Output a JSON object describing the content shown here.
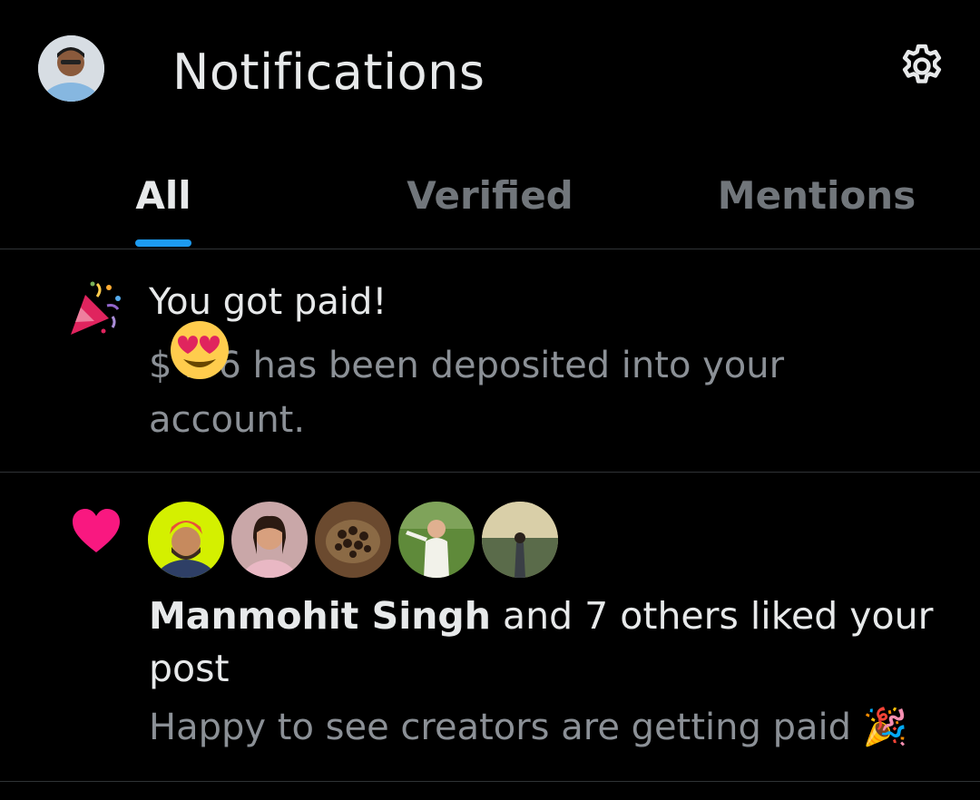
{
  "header": {
    "title": "Notifications",
    "settings_icon": "gear-icon",
    "avatar_icon": "profile-avatar"
  },
  "tabs": [
    {
      "label": "All",
      "active": true
    },
    {
      "label": "Verified",
      "active": false
    },
    {
      "label": "Mentions",
      "active": false
    }
  ],
  "colors": {
    "accent": "#1d9bf0",
    "heart": "#f91880",
    "muted_text": "#71767b",
    "background": "#000000"
  },
  "notifications": [
    {
      "type": "payout",
      "icon": "party-popper-icon",
      "title": "You got paid!",
      "body": "$  .56 has been deposited into your account.",
      "overlay_emoji": "heart-eyes-emoji"
    },
    {
      "type": "like",
      "icon": "heart-icon",
      "liker_avatars": [
        "avatar-manmohit",
        "avatar-2",
        "avatar-3",
        "avatar-4",
        "avatar-5"
      ],
      "actor": "Manmohit Singh",
      "action": " and 7 others liked your post",
      "snippet": "Happy to see creators are getting paid 🎉"
    }
  ]
}
